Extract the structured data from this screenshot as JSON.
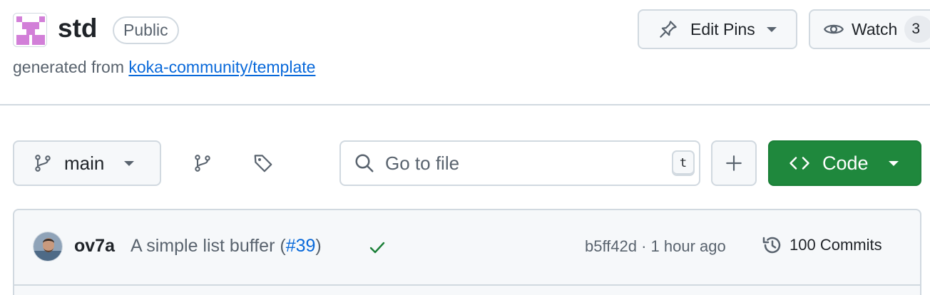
{
  "repo": {
    "name": "std",
    "visibility": "Public",
    "generated_prefix": "generated from",
    "template_link": "koka-community/template",
    "avatar_color": "#d27fd8"
  },
  "actions": {
    "edit_pins_label": "Edit Pins",
    "watch_label": "Watch",
    "watch_count": "3"
  },
  "toolbar": {
    "branch": "main",
    "search_placeholder": "Go to file",
    "search_shortcut": "t",
    "code_label": "Code"
  },
  "latest_commit": {
    "author": "ov7a",
    "message": "A simple list buffer (",
    "pr_link": "#39",
    "message_suffix": ")",
    "status": "success",
    "sha_time": "b5ff42d · 1 hour ago",
    "commits_label": "100 Commits"
  },
  "colors": {
    "accent_link": "#0969da",
    "primary_button": "#1f883d",
    "success_check": "#1a7f37",
    "border": "#d1d9e0"
  }
}
